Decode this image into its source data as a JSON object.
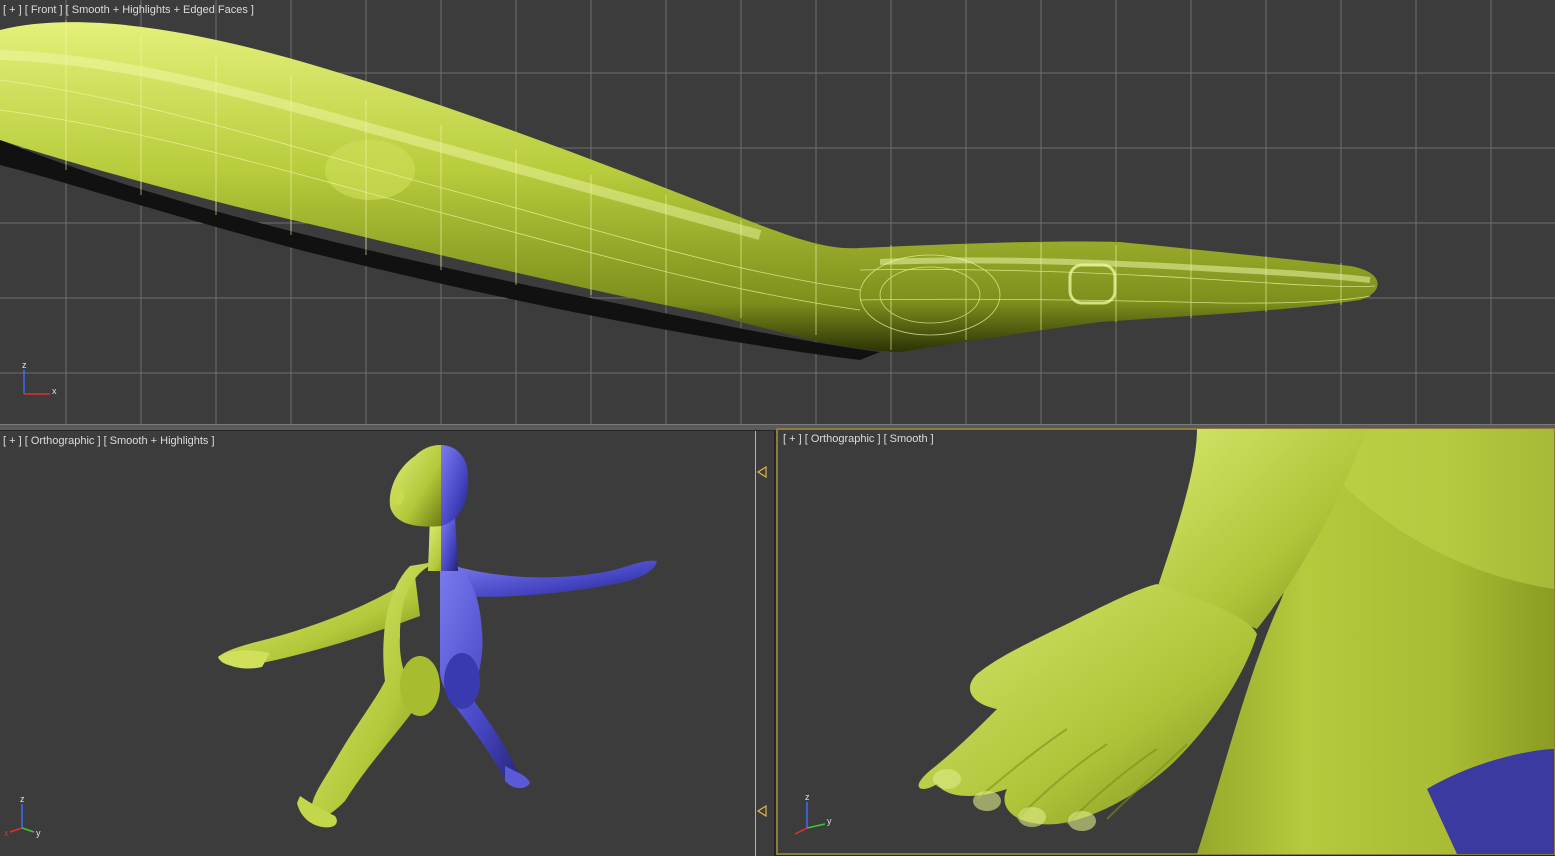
{
  "viewports": {
    "top": {
      "label": "[ + ] [ Front ] [ Smooth + Highlights + Edged Faces ]"
    },
    "bottom_left": {
      "label": "[ + ] [ Orthographic ] [ Smooth + Highlights ]"
    },
    "bottom_right": {
      "label": "[ + ] [ Orthographic ] [ Smooth ]"
    }
  },
  "axis_gizmo": {
    "front": {
      "up": "z",
      "right": "x"
    },
    "ortho": {
      "up": "z",
      "right": "y",
      "left": "x"
    }
  },
  "colors": {
    "viewport_bg": "#3c3c3c",
    "grid": "#6b6b6b",
    "mesh_green": "#b8cc3c",
    "mesh_blue": "#4b4bc8",
    "active_border": "#8f7a3e",
    "divider": "#d9b54a"
  }
}
